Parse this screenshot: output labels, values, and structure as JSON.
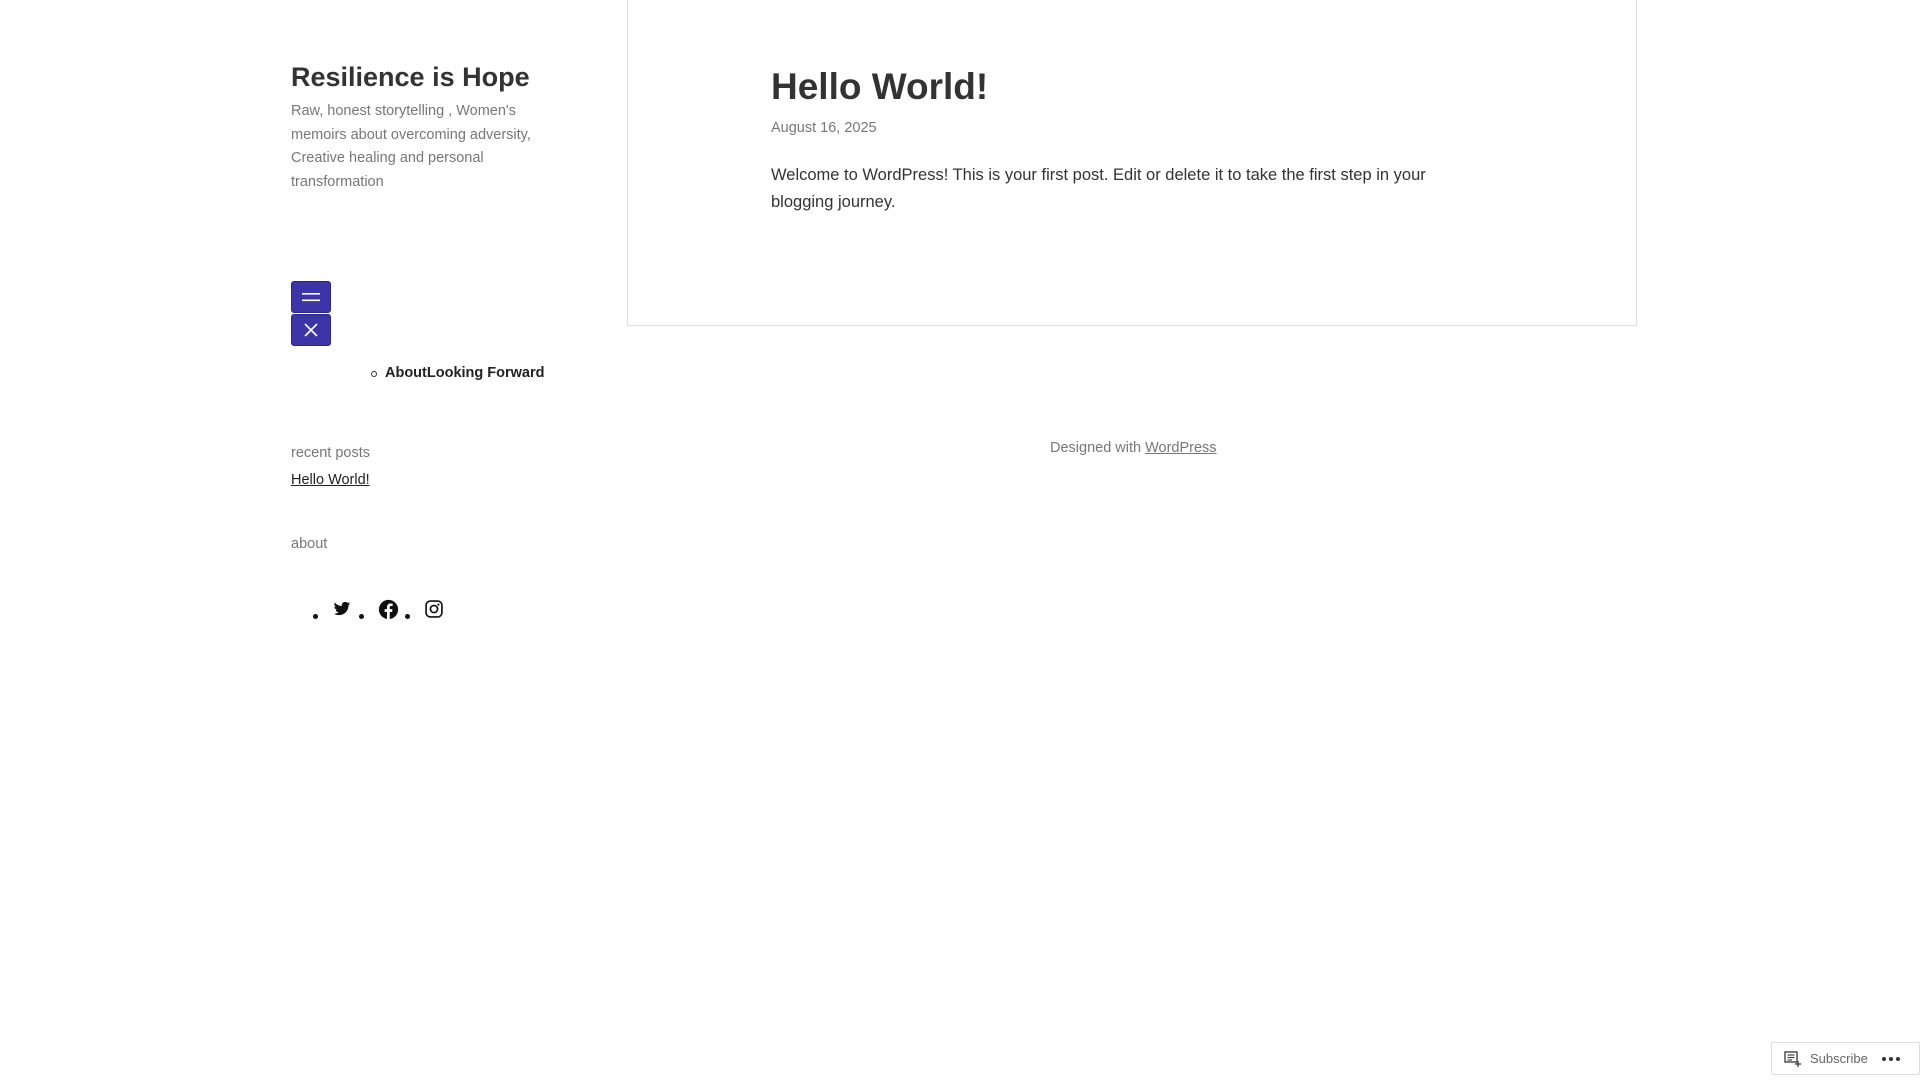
{
  "site": {
    "title": "Resilience is Hope",
    "description": "Raw, honest storytelling , Women's memoirs about overcoming adversity, Creative healing and personal transformation"
  },
  "menu": {
    "open_icon": "hamburger-icon",
    "close_icon": "close-icon",
    "button_color": "#3b35a8",
    "items": [
      {
        "label": "About"
      },
      {
        "label": "Looking Forward"
      }
    ]
  },
  "widgets": {
    "recent_posts": {
      "heading": "recent posts",
      "items": [
        {
          "label": "Hello World!"
        }
      ]
    },
    "about": {
      "heading": "about"
    }
  },
  "social": [
    {
      "icon": "twitter-icon"
    },
    {
      "icon": "facebook-icon"
    },
    {
      "icon": "instagram-icon"
    }
  ],
  "post": {
    "title": "Hello World!",
    "date": "August 16, 2025",
    "body": "Welcome to WordPress! This is your first post. Edit or delete it to take the first step in your blogging journey."
  },
  "footer": {
    "credit_prefix": "Designed with",
    "credit_link": "WordPress"
  },
  "subscribe_bar": {
    "label": "Subscribe",
    "icon": "reader-icon",
    "more_icon": "ellipsis-icon"
  }
}
